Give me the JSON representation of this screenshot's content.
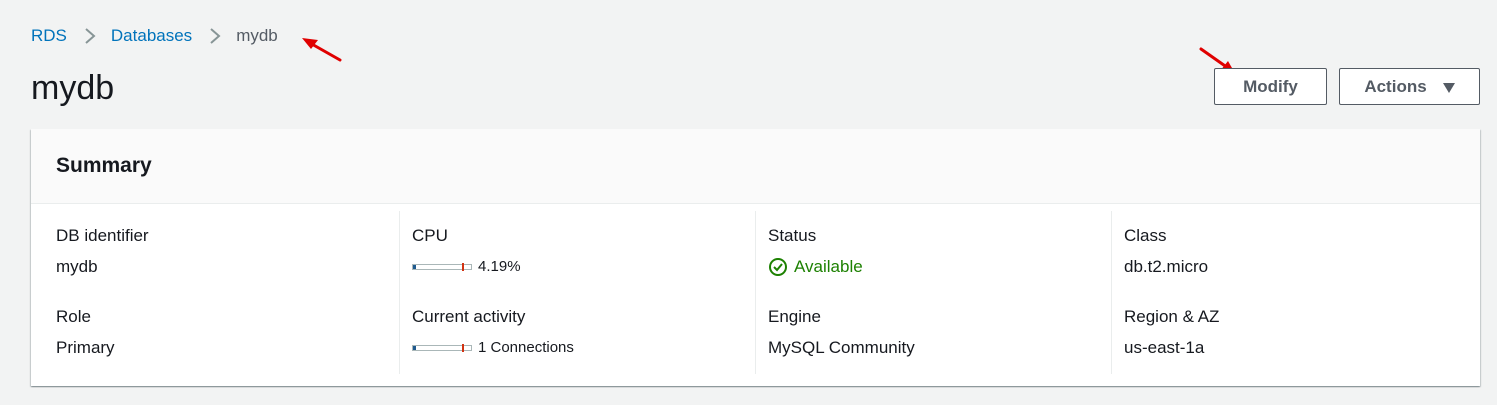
{
  "breadcrumb": {
    "items": [
      {
        "label": "RDS"
      },
      {
        "label": "Databases"
      },
      {
        "label": "mydb"
      }
    ]
  },
  "page": {
    "title": "mydb"
  },
  "header_actions": {
    "modify_label": "Modify",
    "actions_label": "Actions"
  },
  "summary": {
    "title": "Summary",
    "db_identifier": {
      "label": "DB identifier",
      "value": "mydb"
    },
    "role": {
      "label": "Role",
      "value": "Primary"
    },
    "cpu": {
      "label": "CPU",
      "value": "4.19%",
      "fraction": 0.0419
    },
    "current_activity": {
      "label": "Current activity",
      "value": "1 Connections",
      "fraction": 0.04
    },
    "status": {
      "label": "Status",
      "value": "Available",
      "icon": "check-circle-icon",
      "color": "#1d8102"
    },
    "engine": {
      "label": "Engine",
      "value": "MySQL Community"
    },
    "class": {
      "label": "Class",
      "value": "db.t2.micro"
    },
    "region_az": {
      "label": "Region & AZ",
      "value": "us-east-1a"
    }
  },
  "colors": {
    "link": "#0073bb",
    "annotation_arrow": "#e00000",
    "status_ok": "#1d8102",
    "meter_fill": "#1f5a8f",
    "meter_threshold": "#d13212"
  }
}
